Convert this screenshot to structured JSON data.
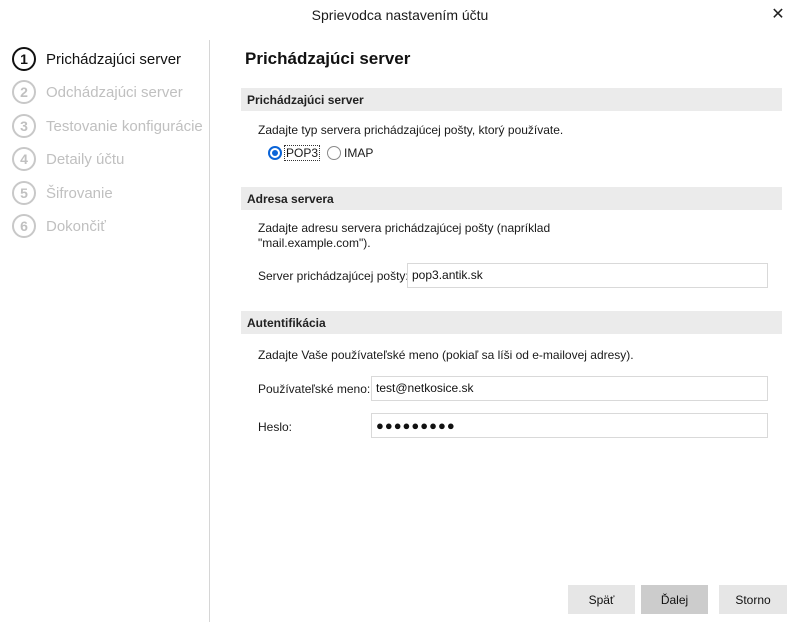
{
  "window": {
    "title": "Sprievodca nastavením účtu"
  },
  "steps": [
    {
      "num": "1",
      "label": "Prichádzajúci server"
    },
    {
      "num": "2",
      "label": "Odchádzajúci server"
    },
    {
      "num": "3",
      "label": "Testovanie konfigurácie"
    },
    {
      "num": "4",
      "label": "Detaily účtu"
    },
    {
      "num": "5",
      "label": "Šifrovanie"
    },
    {
      "num": "6",
      "label": "Dokončiť"
    }
  ],
  "page": {
    "heading": "Prichádzajúci server"
  },
  "incoming": {
    "section_title": "Prichádzajúci server",
    "prompt": "Zadajte typ servera prichádzajúcej pošty, ktorý používate.",
    "option_pop3": "POP3",
    "option_imap": "IMAP",
    "selected": "POP3"
  },
  "address": {
    "section_title": "Adresa servera",
    "prompt_line1": "Zadajte adresu servera prichádzajúcej pošty (napríklad",
    "prompt_line2": "\"mail.example.com\").",
    "server_label": "Server prichádzajúcej pošty:",
    "server_value": "pop3.antik.sk"
  },
  "auth": {
    "section_title": "Autentifikácia",
    "prompt": "Zadajte Vaše používateľské meno (pokiaľ sa líši od e-mailovej adresy).",
    "username_label": "Používateľské meno:",
    "username_value": "test@netkosice.sk",
    "password_label": "Heslo:",
    "password_value": "●●●●●●●●●"
  },
  "buttons": {
    "back": "Späť",
    "next": "Ďalej",
    "cancel": "Storno"
  }
}
